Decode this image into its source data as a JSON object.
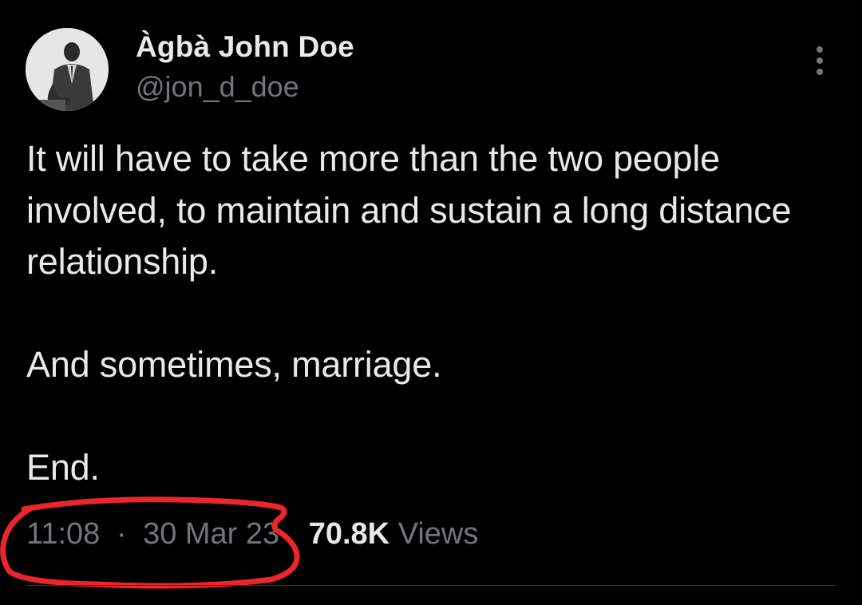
{
  "author": {
    "display_name": "Àgbà John Doe",
    "handle": "@jon_d_doe",
    "avatar_icon": "profile-photo-icon"
  },
  "more_menu": {
    "icon": "more-vertical-icon"
  },
  "tweet": {
    "paragraphs": [
      "It will have to take more than the two people involved, to maintain and sustain a long distance relationship.",
      "And sometimes, marriage.",
      "End."
    ]
  },
  "meta": {
    "time": "11:08",
    "separator": "·",
    "date": "30 Mar 23",
    "views_count": "70.8K",
    "views_label": "Views"
  },
  "colors": {
    "background": "#000000",
    "primary_text": "#e7e9ea",
    "secondary_text": "#71767b",
    "annotation": "#e8262b"
  }
}
